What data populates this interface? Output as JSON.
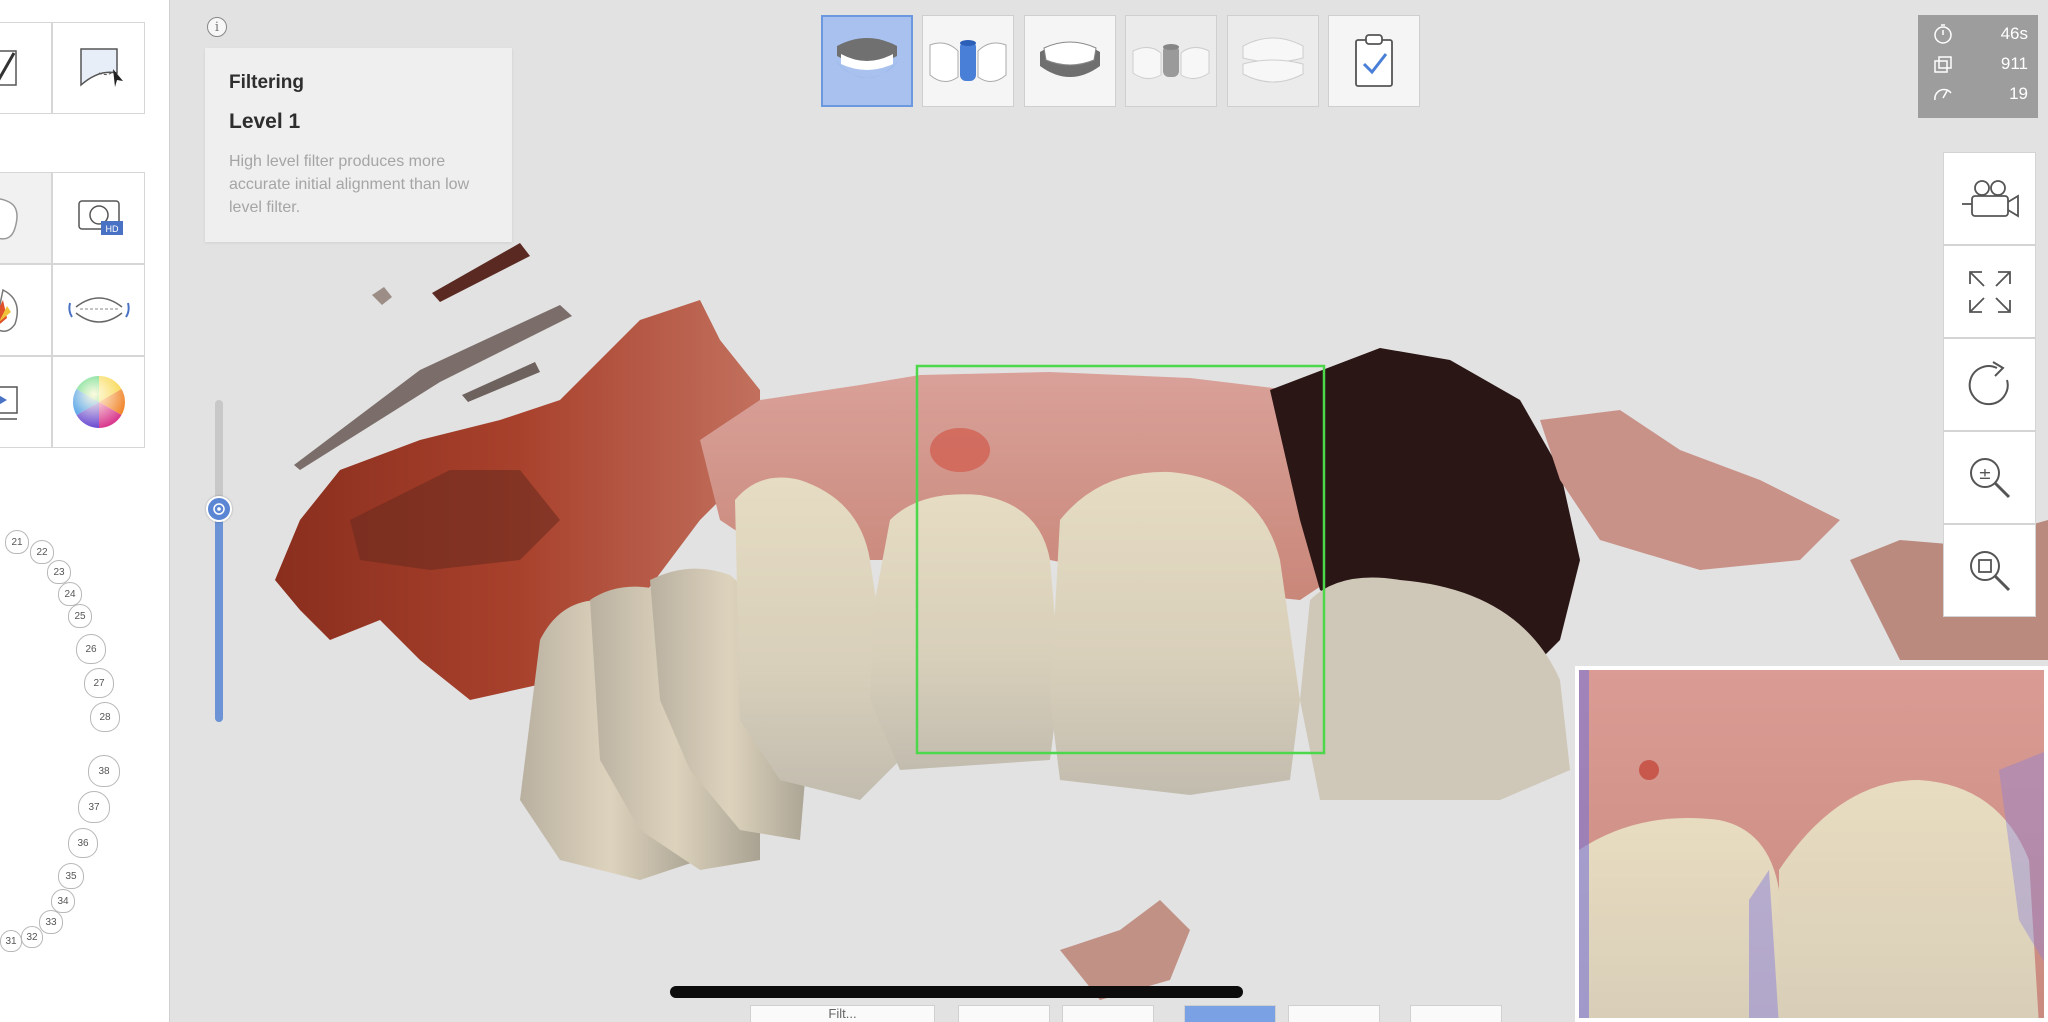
{
  "info": {
    "icon_glyph": "i",
    "title": "Filtering",
    "level": "Level 1",
    "description": "High level filter produces more accurate initial alignment than low level filter."
  },
  "sidebar": {
    "top_tools": [
      "trim-brush-icon",
      "lasso-select-icon"
    ],
    "mid_tools": [
      "tooth-mask-icon",
      "hd-camera-icon",
      "color-paint-icon",
      "bite-align-icon",
      "play-video-icon",
      "color-wheel-icon"
    ],
    "teeth_upper": [
      "21",
      "22",
      "23",
      "24",
      "25",
      "26",
      "27",
      "28"
    ],
    "teeth_lower": [
      "38",
      "37",
      "36",
      "35",
      "34",
      "33",
      "32",
      "31"
    ]
  },
  "stages": [
    {
      "name": "maxilla",
      "state": "active"
    },
    {
      "name": "prep-die",
      "state": "normal"
    },
    {
      "name": "mandible",
      "state": "normal"
    },
    {
      "name": "lower-die",
      "state": "disabled"
    },
    {
      "name": "occlusion",
      "state": "disabled"
    },
    {
      "name": "review-checklist",
      "state": "normal"
    }
  ],
  "stats": {
    "time": "46s",
    "frames": "911",
    "speed": "19"
  },
  "right_tools": [
    "camera-view-icon",
    "fit-screen-icon",
    "rotate-icon",
    "zoom-icon",
    "zoom-fit-icon"
  ],
  "bottom_bar": {
    "first_label": "Filt..."
  },
  "colors": {
    "accent": "#6b93d6",
    "active_stage": "#a8c1ee",
    "selection_box": "#4cd84a",
    "stats_bg": "#9d9d9d"
  }
}
